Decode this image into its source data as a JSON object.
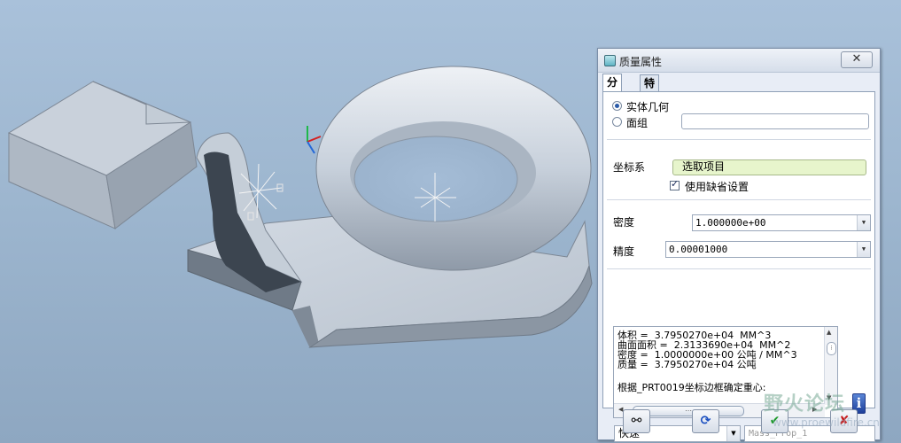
{
  "dialog": {
    "title": "质量属性",
    "close_symbol": "✕",
    "tabs": [
      {
        "label": "分析",
        "active": true
      },
      {
        "label": "特征",
        "active": false
      }
    ],
    "geometry": {
      "options": [
        {
          "label": "实体几何",
          "selected": true
        },
        {
          "label": "面组",
          "selected": false
        }
      ],
      "quilt_value": ""
    },
    "coordsys": {
      "label": "坐标系",
      "value": "选取项目",
      "use_default_label": "使用缺省设置",
      "use_default_checked": true
    },
    "density": {
      "label": "密度",
      "value": "1.000000e+00"
    },
    "accuracy": {
      "label": "精度",
      "value": "0.00001000"
    },
    "results": {
      "lines": [
        "体积 =  3.7950270e+04  MM^3",
        "曲面面积 =  2.3133690e+04  MM^2",
        "密度 =  1.0000000e+00 公吨 / MM^3",
        "质量 =  3.7950270e+04 公吨",
        "",
        "根据_PRT0019坐标边框确定重心:"
      ]
    },
    "mode_select": "快速",
    "name_placeholder": "Mass_Prop_1",
    "footer_buttons": [
      {
        "icon": "glasses-icon",
        "symbol": "⚯"
      },
      {
        "icon": "repeat-icon",
        "symbol": "⟳"
      },
      {
        "icon": "ok-check-icon",
        "symbol": "✔"
      },
      {
        "icon": "cancel-x-icon",
        "symbol": "✘"
      }
    ]
  },
  "watermark": {
    "title": "野火论坛",
    "url": "www.proewildfire.cn"
  },
  "colors": {
    "viewport_bg": "#9fb8d1",
    "part_surface": "#bcc6d2",
    "coordsys_field": "#e7f5cc",
    "ok_green": "#1d9a2a",
    "cancel_red": "#c81e1e"
  }
}
